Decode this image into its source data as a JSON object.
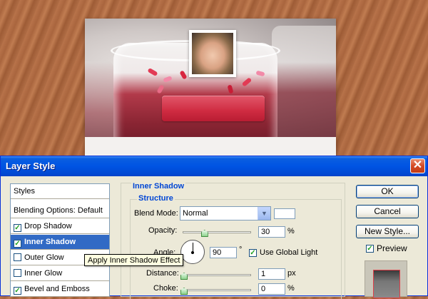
{
  "dialog": {
    "title": "Layer Style",
    "close_label": "✕"
  },
  "left_panel": {
    "items": [
      {
        "label": "Styles",
        "has_checkbox": false,
        "checked": false,
        "selected": false
      },
      {
        "label": "Blending Options: Default",
        "has_checkbox": false,
        "checked": false,
        "selected": false
      },
      {
        "label": "Drop Shadow",
        "has_checkbox": true,
        "checked": true,
        "selected": false
      },
      {
        "label": "Inner Shadow",
        "has_checkbox": true,
        "checked": true,
        "selected": true
      },
      {
        "label": "Outer Glow",
        "has_checkbox": true,
        "checked": false,
        "selected": false
      },
      {
        "label": "Inner Glow",
        "has_checkbox": true,
        "checked": false,
        "selected": false
      },
      {
        "label": "Bevel and Emboss",
        "has_checkbox": true,
        "checked": true,
        "selected": false
      }
    ]
  },
  "inner_shadow": {
    "section_title": "Inner Shadow",
    "group_title": "Structure",
    "blend_mode_label": "Blend Mode:",
    "blend_mode_value": "Normal",
    "blend_color": "#ffffff",
    "opacity_label": "Opacity:",
    "opacity_value": "30",
    "opacity_fraction": 0.3,
    "opacity_unit": "%",
    "angle_label": "Angle:",
    "angle_value": "90",
    "angle_unit": "°",
    "use_global_light_label": "Use Global Light",
    "use_global_light_checked": true,
    "distance_label": "Distance:",
    "distance_value": "1",
    "distance_unit": "px",
    "choke_label": "Choke:",
    "choke_value": "0",
    "choke_unit": "%"
  },
  "buttons": {
    "ok": "OK",
    "cancel": "Cancel",
    "new_style": "New Style...",
    "preview_label": "Preview",
    "preview_checked": true
  },
  "tooltip": {
    "text": "Apply Inner Shadow Effect"
  },
  "colors": {
    "titlebar": "#0054e3",
    "selection": "#316ac5",
    "group_title": "#0046d5",
    "canvas_button": "#cf2b41"
  }
}
